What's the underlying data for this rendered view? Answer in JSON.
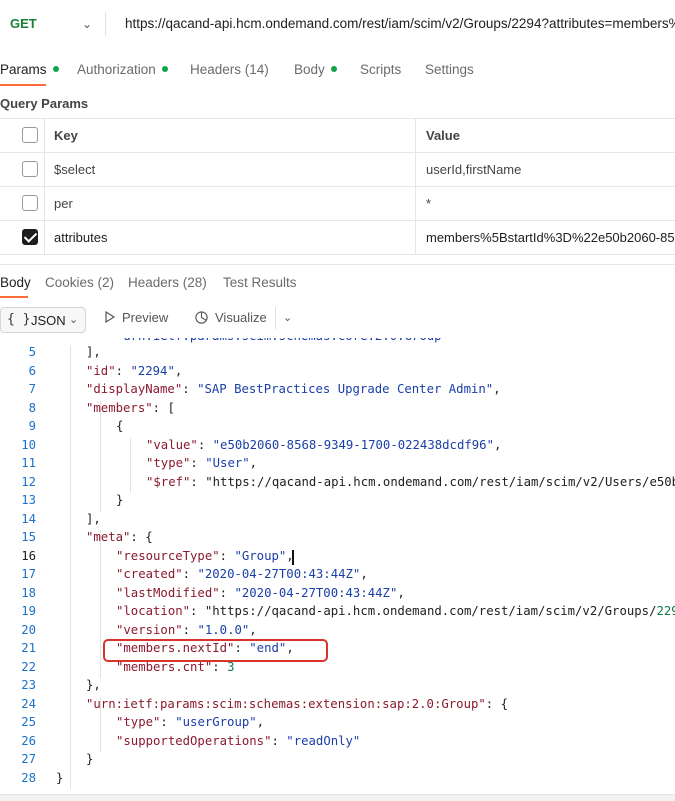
{
  "request": {
    "method": "GET",
    "url": "https://qacand-api.hcm.ondemand.com/rest/iam/scim/v2/Groups/2294?attributes=members%"
  },
  "request_tabs": [
    {
      "label": "Params",
      "dot": true,
      "active": true
    },
    {
      "label": "Authorization",
      "dot": true
    },
    {
      "label": "Headers (14)"
    },
    {
      "label": "Body",
      "dot": true
    },
    {
      "label": "Scripts"
    },
    {
      "label": "Settings"
    }
  ],
  "query_params": {
    "title": "Query Params",
    "header": {
      "key": "Key",
      "value": "Value"
    },
    "rows": [
      {
        "key": "$select",
        "value": "userId,firstName",
        "checked": false
      },
      {
        "key": "per",
        "value": "*",
        "checked": false
      },
      {
        "key": "attributes",
        "value": "members%5BstartId%3D%22e50b2060-85",
        "checked": true
      }
    ]
  },
  "response_tabs": [
    {
      "label": "Body",
      "active": true
    },
    {
      "label": "Cookies (2)"
    },
    {
      "label": "Headers (28)"
    },
    {
      "label": "Test Results"
    }
  ],
  "response_toolbar": {
    "format_icon": "{ }",
    "format": "JSON",
    "preview": "Preview",
    "visualize": "Visualize"
  },
  "code": {
    "top_partial": "urn:ietf:params:scim:schemas:core:2.0:Group",
    "lines": [
      {
        "n": "5",
        "text": "],"
      },
      {
        "n": "6",
        "text": "\"id\": \"2294\","
      },
      {
        "n": "7",
        "text": "\"displayName\": \"SAP BestPractices Upgrade Center Admin\","
      },
      {
        "n": "8",
        "text": "\"members\": ["
      },
      {
        "n": "9",
        "text": "{"
      },
      {
        "n": "10",
        "text": "\"value\": \"e50b2060-8568-9349-1700-022438dcdf96\","
      },
      {
        "n": "11",
        "text": "\"type\": \"User\","
      },
      {
        "n": "12",
        "text": "\"$ref\": \"https://qacand-api.hcm.ondemand.com/rest/iam/scim/v2/Users/e50b"
      },
      {
        "n": "13",
        "text": "}"
      },
      {
        "n": "14",
        "text": "],"
      },
      {
        "n": "15",
        "text": "\"meta\": {"
      },
      {
        "n": "16",
        "text": "\"resourceType\": \"Group\","
      },
      {
        "n": "17",
        "text": "\"created\": \"2020-04-27T00:43:44Z\","
      },
      {
        "n": "18",
        "text": "\"lastModified\": \"2020-04-27T00:43:44Z\","
      },
      {
        "n": "19",
        "text": "\"location\": \"https://qacand-api.hcm.ondemand.com/rest/iam/scim/v2/Groups/229"
      },
      {
        "n": "20",
        "text": "\"version\": \"1.0.0\","
      },
      {
        "n": "21",
        "text": "\"members.nextId\": \"end\","
      },
      {
        "n": "22",
        "text": "\"members.cnt\": 3"
      },
      {
        "n": "23",
        "text": "},"
      },
      {
        "n": "24",
        "text": "\"urn:ietf:params:scim:schemas:extension:sap:2.0:Group\": {"
      },
      {
        "n": "25",
        "text": "\"type\": \"userGroup\","
      },
      {
        "n": "26",
        "text": "\"supportedOperations\": \"readOnly\""
      },
      {
        "n": "27",
        "text": "}"
      },
      {
        "n": "28",
        "text": "}"
      }
    ]
  },
  "colors": {
    "accent": "#ff6c37",
    "method": "#1a7f37",
    "annotation": "#d9342b"
  }
}
